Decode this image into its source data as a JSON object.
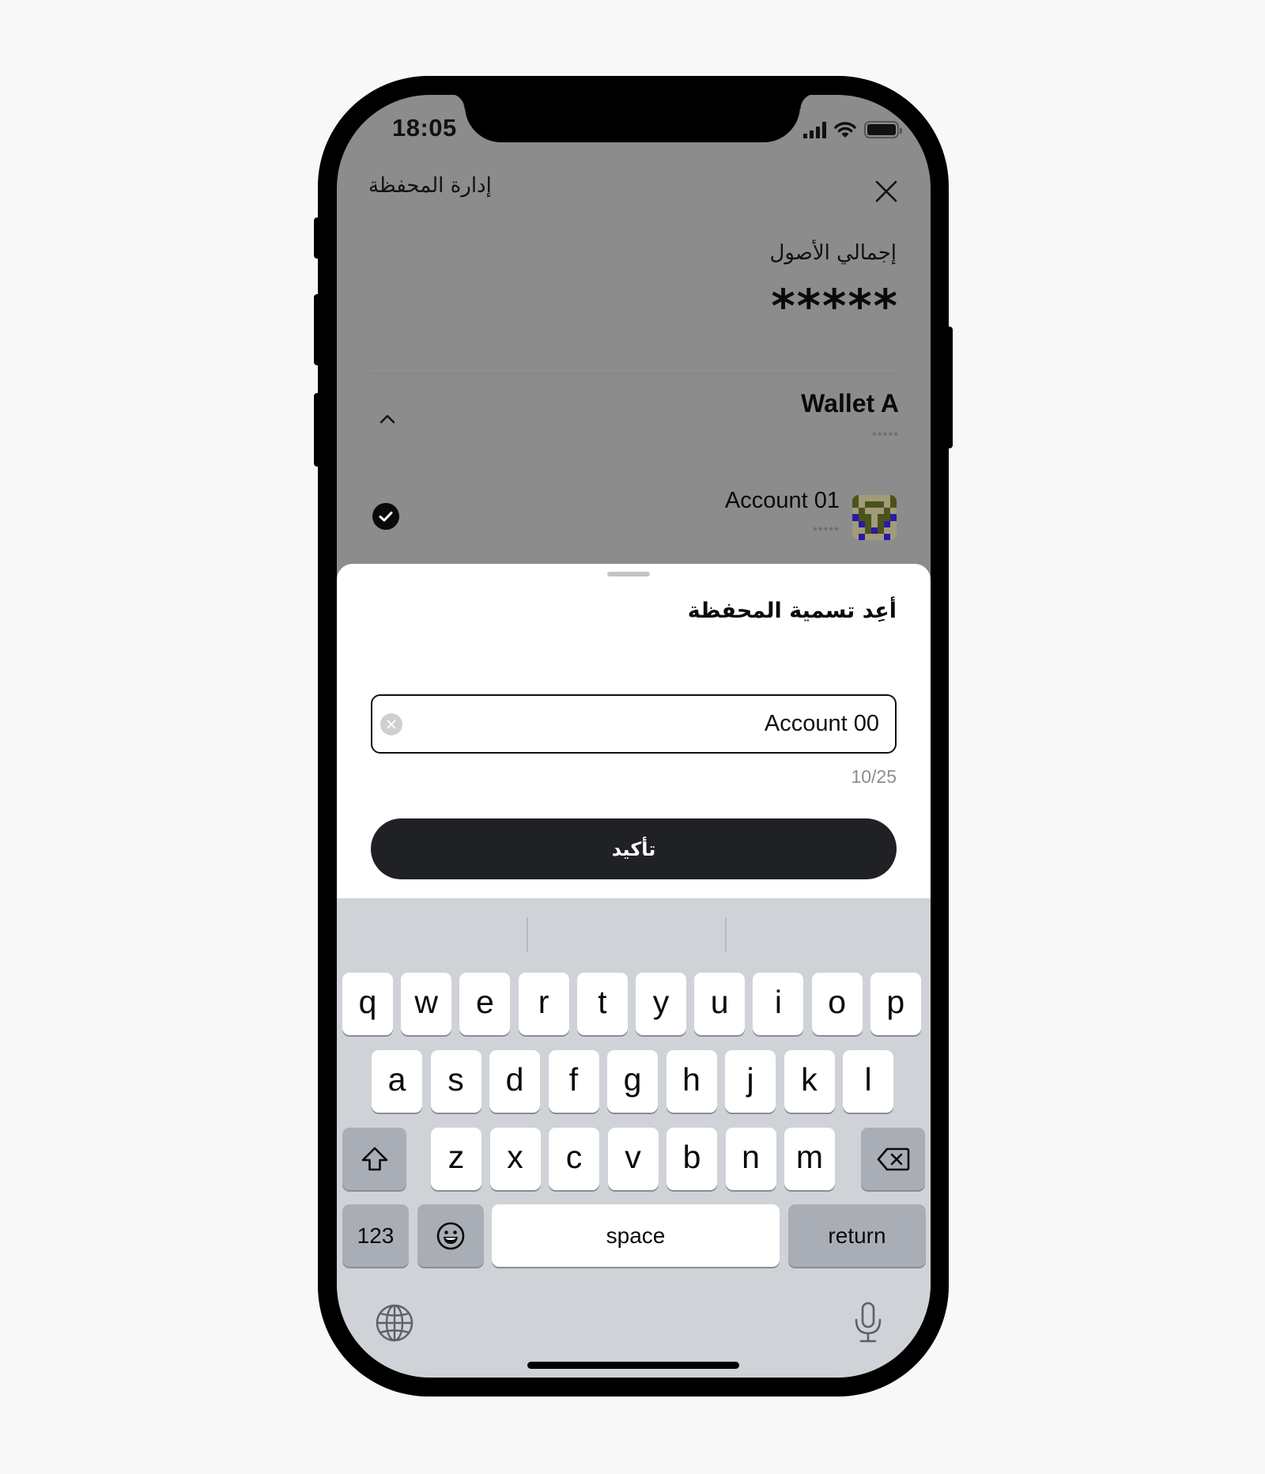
{
  "status_bar": {
    "time": "18:05",
    "signal_icon": "cellular-signal-icon",
    "wifi_icon": "wifi-icon",
    "battery_icon": "battery-icon"
  },
  "header": {
    "title": "إدارة المحفظة",
    "close_icon": "close-icon"
  },
  "assets": {
    "label": "إجمالي الأصول",
    "value": "*****"
  },
  "wallet": {
    "name": "Wallet A",
    "balance": "*****",
    "toggle_icon": "chevron-up-icon",
    "accounts": [
      {
        "name": "Account 01",
        "balance": "*****",
        "selected": true,
        "avatar_icon": "pixel-avatar"
      }
    ]
  },
  "rename_sheet": {
    "title": "أعِد تسمية المحفظة",
    "input_value": "Account 00",
    "clear_icon": "clear-input-icon",
    "char_count": "10/25",
    "confirm_label": "تأكيد"
  },
  "keyboard": {
    "row1": [
      "q",
      "w",
      "e",
      "r",
      "t",
      "y",
      "u",
      "i",
      "o",
      "p"
    ],
    "row2": [
      "a",
      "s",
      "d",
      "f",
      "g",
      "h",
      "j",
      "k",
      "l"
    ],
    "row3": [
      "z",
      "x",
      "c",
      "v",
      "b",
      "n",
      "m"
    ],
    "numbers_label": "123",
    "space_label": "space",
    "return_label": "return",
    "shift_icon": "shift-icon",
    "delete_icon": "backspace-icon",
    "emoji_icon": "emoji-icon",
    "globe_icon": "globe-icon",
    "mic_icon": "microphone-icon"
  },
  "avatar_colors": {
    "olive": "#4a5419",
    "tan": "#a29b79",
    "blue": "#2a1aa8"
  }
}
